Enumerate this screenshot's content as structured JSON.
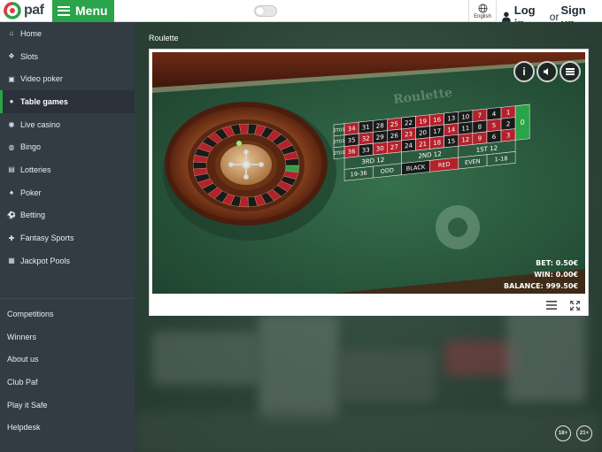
{
  "header": {
    "logo_text": "paf",
    "menu_label": "Menu",
    "language_label": "English",
    "login_label": "Log in",
    "or_label": "or",
    "signup_label": "Sign up"
  },
  "sidebar": {
    "primary": [
      {
        "label": "Home",
        "icon": "home-icon"
      },
      {
        "label": "Slots",
        "icon": "slots-icon"
      },
      {
        "label": "Video poker",
        "icon": "video-poker-icon"
      },
      {
        "label": "Table games",
        "icon": "table-games-icon",
        "active": true
      },
      {
        "label": "Live casino",
        "icon": "live-casino-icon"
      },
      {
        "label": "Bingo",
        "icon": "bingo-icon"
      },
      {
        "label": "Lotteries",
        "icon": "lotteries-icon"
      },
      {
        "label": "Poker",
        "icon": "poker-icon"
      },
      {
        "label": "Betting",
        "icon": "betting-icon"
      },
      {
        "label": "Fantasy Sports",
        "icon": "fantasy-sports-icon"
      },
      {
        "label": "Jackpot Pools",
        "icon": "jackpot-pools-icon"
      }
    ],
    "secondary": [
      {
        "label": "Competitions"
      },
      {
        "label": "Winners"
      },
      {
        "label": "About us"
      },
      {
        "label": "Club Paf"
      },
      {
        "label": "Play it Safe"
      },
      {
        "label": "Helpdesk"
      }
    ]
  },
  "page": {
    "title": "Roulette"
  },
  "game": {
    "felt_title": "Roulette",
    "hud_buttons": [
      {
        "label": "i",
        "icon": "info-icon"
      },
      {
        "label": "",
        "icon": "sound-icon"
      },
      {
        "label": "",
        "icon": "menu-icon"
      }
    ],
    "bet_label": "BET: 0.50€",
    "win_label": "WIN: 0.00€",
    "balance_label": "BALANCE: 999.50€",
    "board": {
      "zero": "0",
      "rows": [
        [
          "3",
          "6",
          "9",
          "12",
          "15",
          "18",
          "21",
          "24",
          "27",
          "30",
          "33",
          "36"
        ],
        [
          "2",
          "5",
          "8",
          "11",
          "14",
          "17",
          "20",
          "23",
          "26",
          "29",
          "32",
          "35"
        ],
        [
          "1",
          "4",
          "7",
          "10",
          "13",
          "16",
          "19",
          "22",
          "25",
          "28",
          "31",
          "34"
        ]
      ],
      "red_numbers": [
        "1",
        "3",
        "5",
        "7",
        "9",
        "12",
        "14",
        "16",
        "18",
        "19",
        "21",
        "23",
        "25",
        "27",
        "30",
        "32",
        "34",
        "36"
      ],
      "columns": [
        "2TO1",
        "2TO1",
        "2TO1"
      ],
      "dozens": [
        "1ST 12",
        "2ND 12",
        "3RD 12"
      ],
      "outside": [
        "1-18",
        "EVEN",
        "RED",
        "BLACK",
        "ODD",
        "19-36"
      ]
    }
  },
  "badges": [
    {
      "label": "18+",
      "icon": "age-18-icon"
    },
    {
      "label": "21+",
      "icon": "age-21-icon"
    }
  ],
  "colors": {
    "brand_green": "#2aa34a",
    "sidebar_bg": "#333b43",
    "felt_green": "#2c5a3e",
    "pocket_red": "#b3212c",
    "pocket_black": "#1a1a1a"
  }
}
